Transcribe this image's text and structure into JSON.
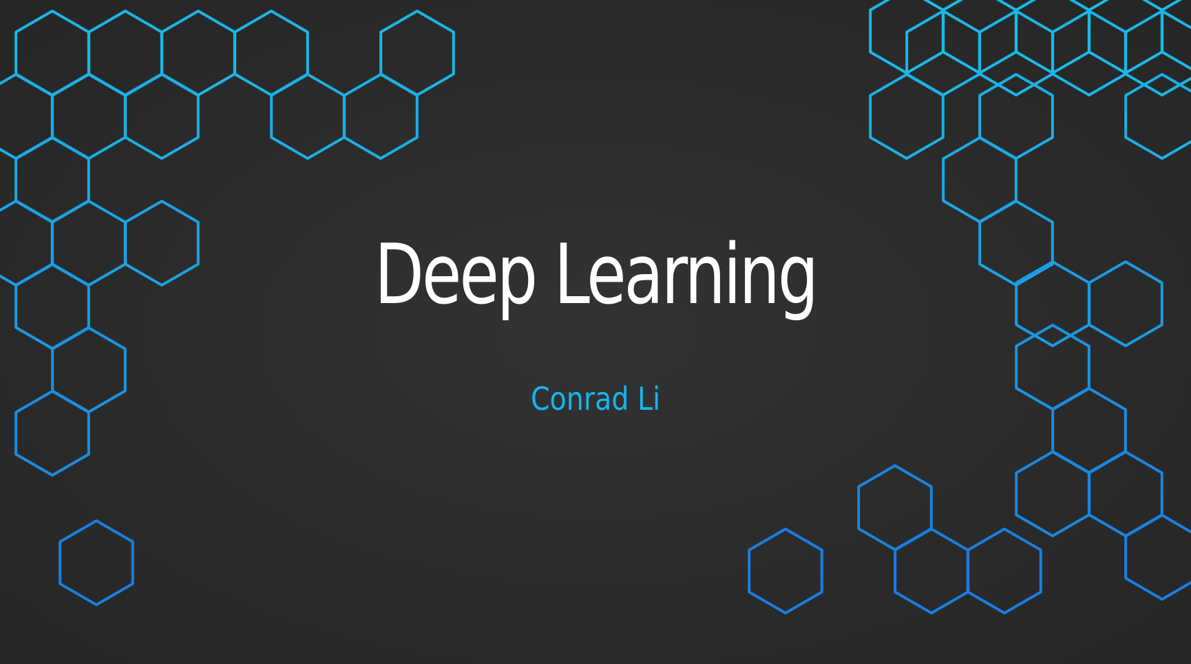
{
  "slide": {
    "title": "Deep Learning",
    "subtitle": "Conrad Li"
  },
  "colors": {
    "background": "#2a2a2a",
    "title": "#ffffff",
    "subtitle": "#13b7ef",
    "hex_top": "#1bbde8",
    "hex_bottom": "#1a78e0"
  },
  "decoration": {
    "shape": "hexagon-outline",
    "left_cluster_count": 18,
    "right_cluster_count": 28
  }
}
